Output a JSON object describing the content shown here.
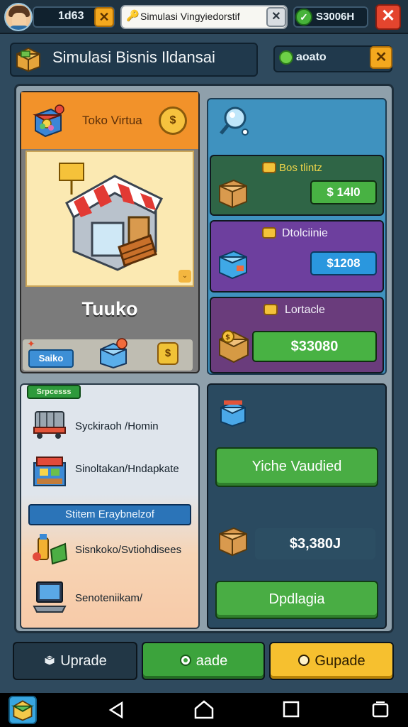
{
  "top_bar": {
    "level_value": "1d63",
    "close_glyph": "✕",
    "search_text": "Simulasi Vingyiedorstif",
    "search_clear_glyph": "✕",
    "key_glyph": "🔑",
    "coins_check_glyph": "✓",
    "coins_value": "S3006H",
    "top_close_glyph": "✕"
  },
  "header": {
    "title": "Simulasi Bisnis  Ildansai",
    "filter_label": "aoato",
    "filter_close_glyph": "✕"
  },
  "store": {
    "card_title": "Toko Virtua",
    "coin_badge": "$",
    "name": "Tuuko",
    "footer_button": "Saiko",
    "footer_coin": "$",
    "corner_glyph": "⌄"
  },
  "offers": [
    {
      "label": "Bos tlintz",
      "price": "$ 14l0"
    },
    {
      "label": "Dtolciinie",
      "price": "$1208"
    },
    {
      "label": "Lortacle",
      "price": "$33080"
    }
  ],
  "list": {
    "badge": "Srpcesss",
    "banner": "Stitem  Eraybnelzof",
    "items": [
      {
        "label": "Syckiraoh /Homin"
      },
      {
        "label": "Sinoltakan/Hndapkate"
      },
      {
        "label": "Sisnkoko/Svtiohdisees"
      },
      {
        "label": "Senoteniikam/"
      }
    ]
  },
  "actions": {
    "button_1": "Yiche Vaudied",
    "price": "$3,380J",
    "button_2": "Dpdlagia"
  },
  "bottom_buttons": {
    "upgrade_dark": "Uprade",
    "trade": "aade",
    "upgrade_gold": "Gupade"
  },
  "icons": [
    "avatar",
    "key-icon",
    "check-icon",
    "close-icon",
    "cart-icon",
    "store-icon",
    "coin-icon",
    "box-icon",
    "magnifier-icon",
    "nav-back-icon",
    "nav-home-icon",
    "nav-recent-icon",
    "nav-menu-icon"
  ],
  "colors": {
    "accent_orange": "#f2922a",
    "accent_green": "#48b243",
    "accent_gold": "#f6c02f",
    "accent_blue": "#3f92bf",
    "danger_red": "#e4452e"
  }
}
